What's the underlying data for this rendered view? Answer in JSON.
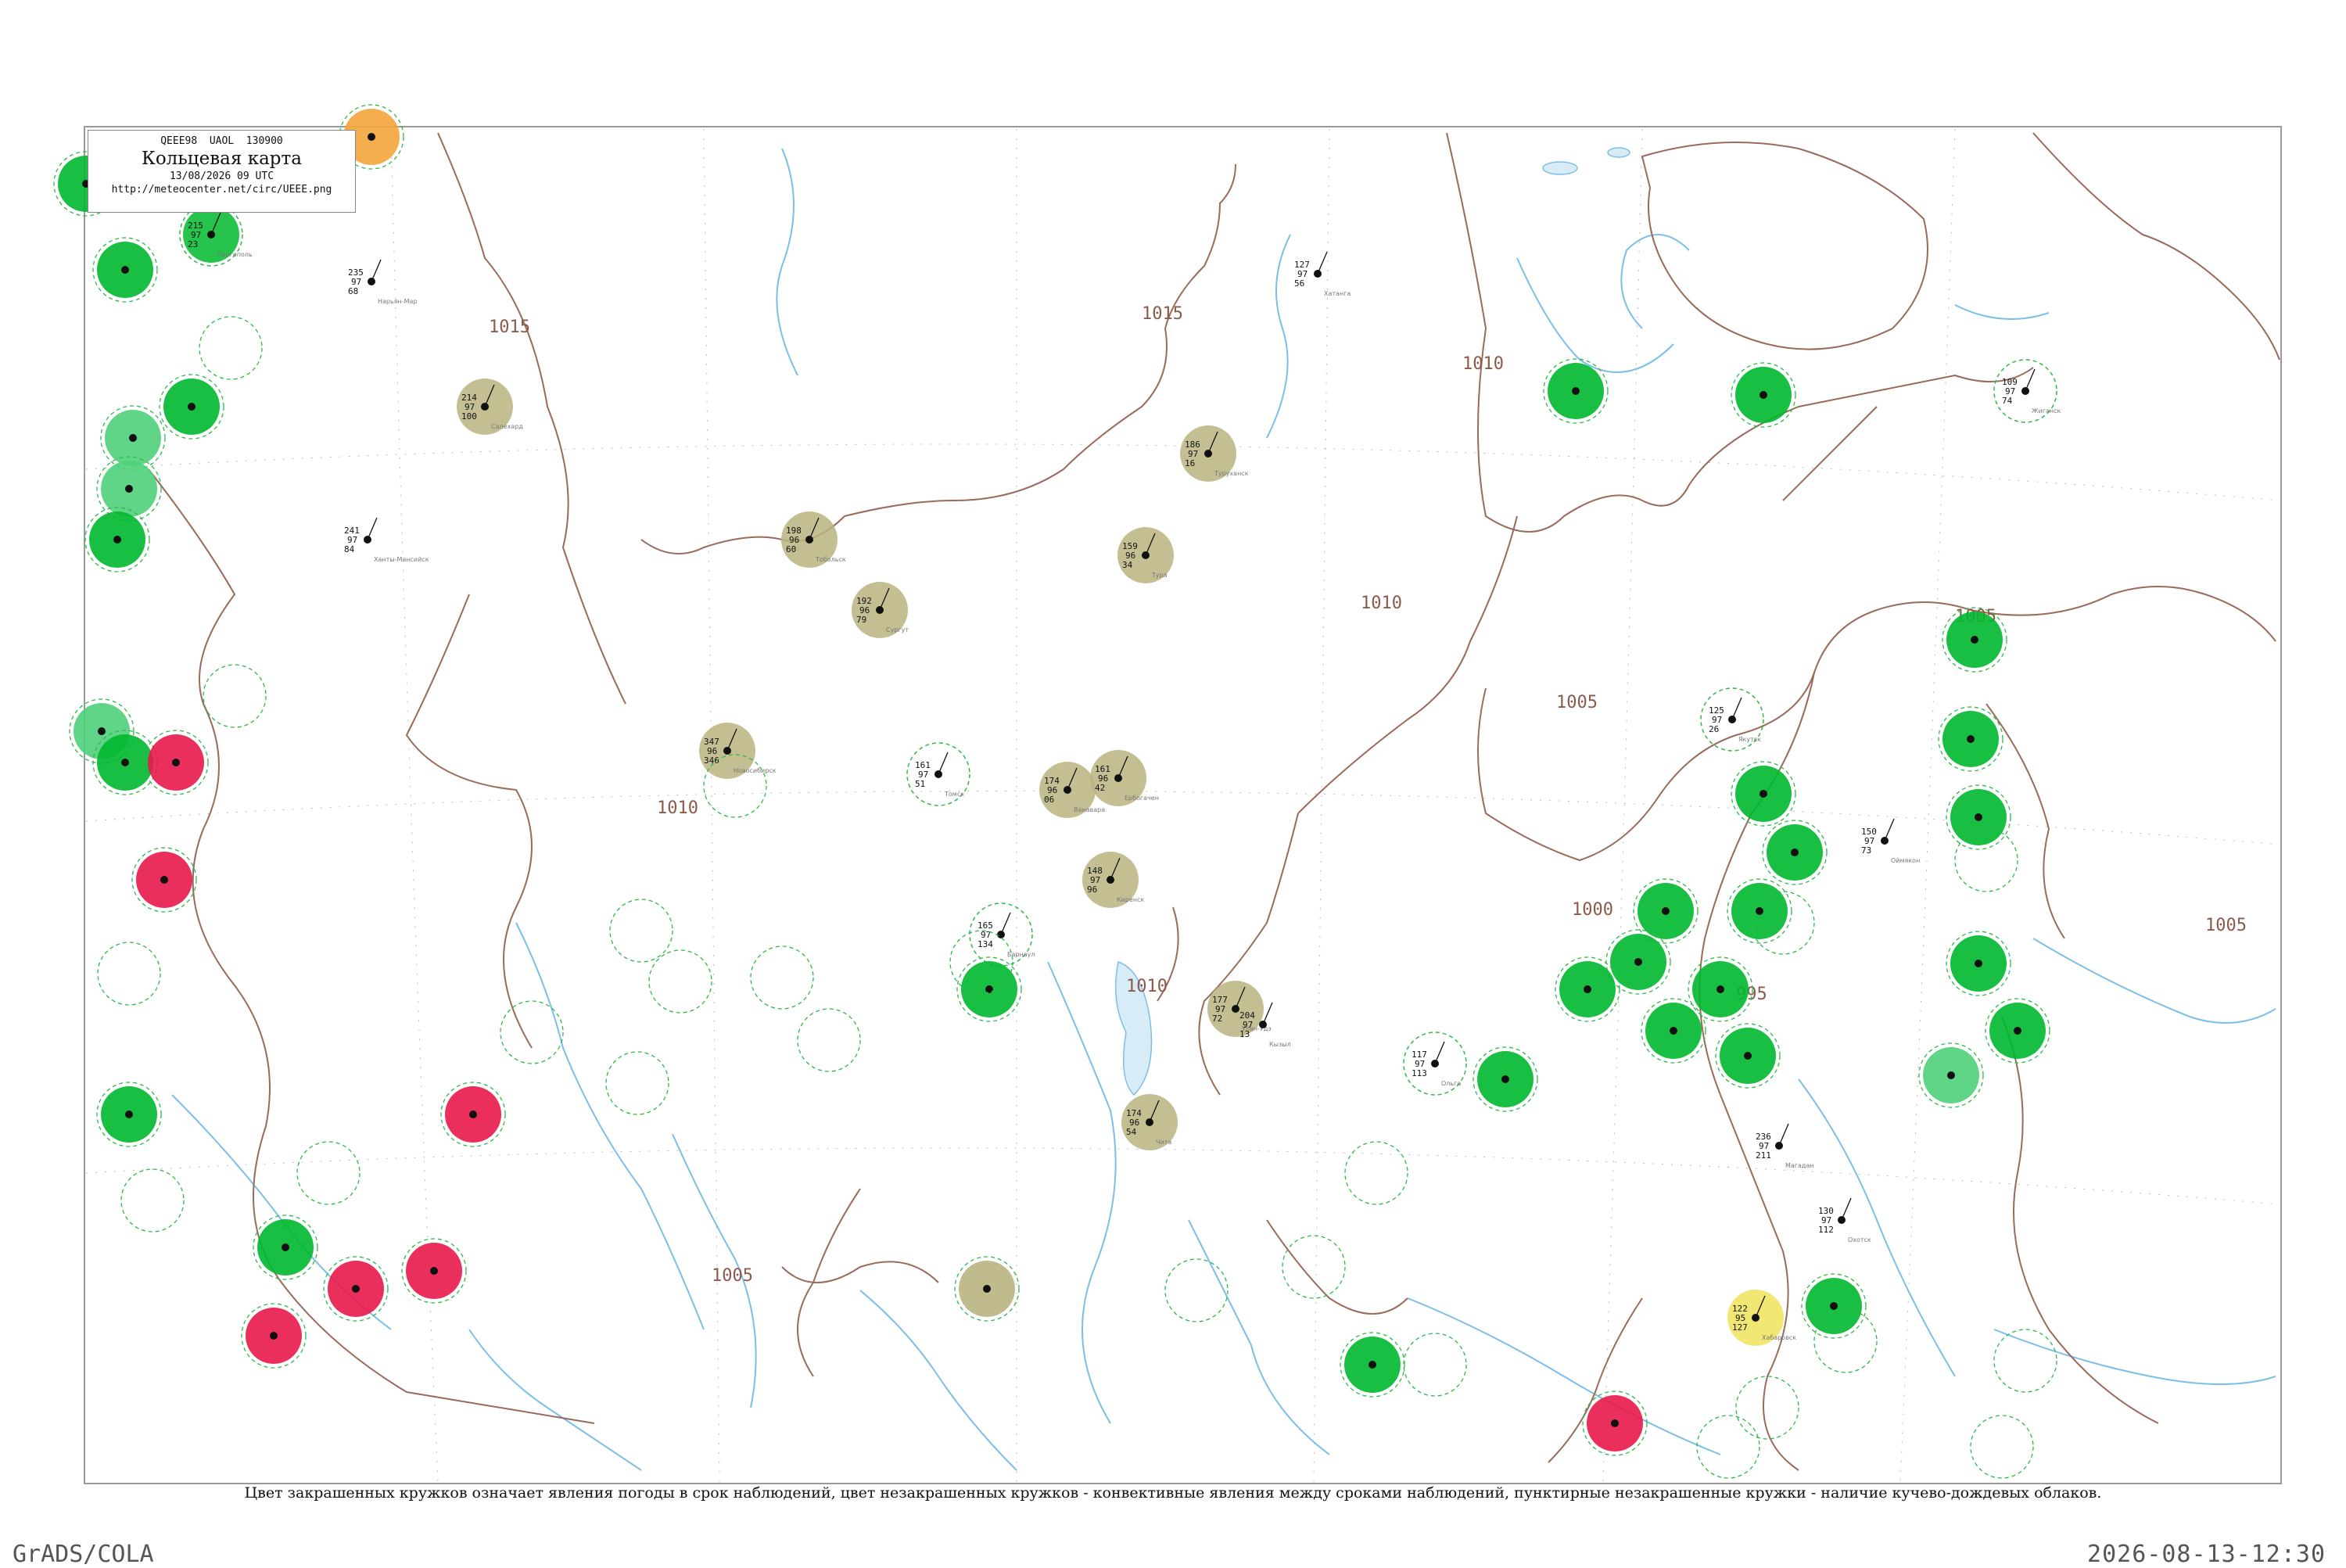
{
  "header": {
    "code_line": "QEEE98  UAOL  130900",
    "title": "Кольцевая карта",
    "date": "13/08/2026 09 UTC",
    "url": "http://meteocenter.net/circ/UEEE.png"
  },
  "legend": {
    "caption": "Цвет закрашенных кружков означает явления погоды в срок наблюдений, цвет незакрашенных кружков - конвективные явления между сроками наблюдений, пунктирные незакрашенные кружки - наличие кучево-дождевых облаков."
  },
  "footer": {
    "left": "GrADS/COLA",
    "right": "2026-08-13-12:30"
  },
  "colors": {
    "rain": "#00b82e",
    "shower": "#4fd07a",
    "thunder": "#e8184a",
    "fog": "#b8b480",
    "haze": "#f0e35a",
    "smoke": "#f3a53a",
    "isobar": "#9a6a5a",
    "river": "#6fb8e8",
    "dashed_circle": "#2fb84a"
  },
  "isobars": [
    {
      "label": "1015",
      "at": "west-center"
    },
    {
      "label": "1015",
      "at": "north-center"
    },
    {
      "label": "1010",
      "at": "northeast"
    },
    {
      "label": "1010",
      "at": "center"
    },
    {
      "label": "1010",
      "at": "center-east"
    },
    {
      "label": "1010",
      "at": "center-south"
    },
    {
      "label": "1005",
      "at": "east"
    },
    {
      "label": "1005",
      "at": "south-center"
    },
    {
      "label": "1005",
      "at": "far-east"
    },
    {
      "label": "1000",
      "at": "east"
    },
    {
      "label": "995",
      "at": "east"
    },
    {
      "label": "1005",
      "at": "far-east-south"
    }
  ],
  "stations": [
    {
      "id": "s1",
      "name": "Каргополь",
      "p": "215",
      "t": "97",
      "td": "23",
      "w": "green"
    },
    {
      "id": "s2",
      "name": "Нарьян-Мар",
      "p": "235",
      "t": "97",
      "td": "68",
      "w": "none"
    },
    {
      "id": "s3",
      "name": "Салехард",
      "p": "214",
      "t": "97",
      "td": "100",
      "w": "fog"
    },
    {
      "id": "s4",
      "name": "Ханты-Мансийск",
      "p": "241",
      "t": "97",
      "td": "84",
      "w": "none"
    },
    {
      "id": "s5",
      "name": "Тобольск",
      "p": "198",
      "t": "96",
      "td": "60",
      "w": "fog"
    },
    {
      "id": "s6",
      "name": "Сургут",
      "p": "192",
      "t": "96",
      "td": "79",
      "w": "fog"
    },
    {
      "id": "s7",
      "name": "Туруханск",
      "p": "186",
      "t": "97",
      "td": "16",
      "w": "fog"
    },
    {
      "id": "s8",
      "name": "Тура",
      "p": "159",
      "t": "96",
      "td": "34",
      "w": "fog"
    },
    {
      "id": "s9",
      "name": "Хатанга",
      "p": "127",
      "t": "97",
      "td": "56",
      "w": "none"
    },
    {
      "id": "s10",
      "name": "Жиганск",
      "p": "109",
      "t": "97",
      "td": "74",
      "w": "dashed"
    },
    {
      "id": "s11",
      "name": "Ванавара",
      "p": "174",
      "t": "96",
      "td": "06",
      "w": "fog"
    },
    {
      "id": "s12",
      "name": "Ербогачен",
      "p": "161",
      "t": "96",
      "td": "42",
      "w": "fog"
    },
    {
      "id": "s13",
      "name": "Киренск",
      "p": "148",
      "t": "97",
      "td": "96",
      "w": "fog"
    },
    {
      "id": "s14",
      "name": "Новосибирск",
      "p": "347",
      "t": "96",
      "td": "346",
      "w": "fog"
    },
    {
      "id": "s15",
      "name": "Томск",
      "p": "161",
      "t": "97",
      "td": "51",
      "w": "dashed"
    },
    {
      "id": "s16",
      "name": "Якутск",
      "p": "125",
      "t": "97",
      "td": "26",
      "w": "dashed"
    },
    {
      "id": "s17",
      "name": "Оймякон",
      "p": "150",
      "t": "97",
      "td": "73",
      "w": "none"
    },
    {
      "id": "s18",
      "name": "Ольга",
      "p": "117",
      "t": "97",
      "td": "113",
      "w": "dashed"
    },
    {
      "id": "s19",
      "name": "Чита",
      "p": "174",
      "t": "96",
      "td": "54",
      "w": "fog"
    },
    {
      "id": "s20",
      "name": "Улан-Удэ",
      "p": "177",
      "t": "97",
      "td": "72",
      "w": "fog"
    },
    {
      "id": "s21",
      "name": "Хабаровск",
      "p": "122",
      "t": "95",
      "td": "127",
      "w": "haze"
    },
    {
      "id": "s22",
      "name": "Барнаул",
      "p": "165",
      "t": "97",
      "td": "134",
      "w": "dashed"
    },
    {
      "id": "s23",
      "name": "Кызыл",
      "p": "204",
      "t": "97",
      "td": "13",
      "w": "none"
    },
    {
      "id": "s24",
      "name": "Магадан",
      "p": "236",
      "t": "97",
      "td": "211",
      "w": "none"
    },
    {
      "id": "s25",
      "name": "Охотск",
      "p": "130",
      "t": "97",
      "td": "112",
      "w": "none"
    }
  ]
}
